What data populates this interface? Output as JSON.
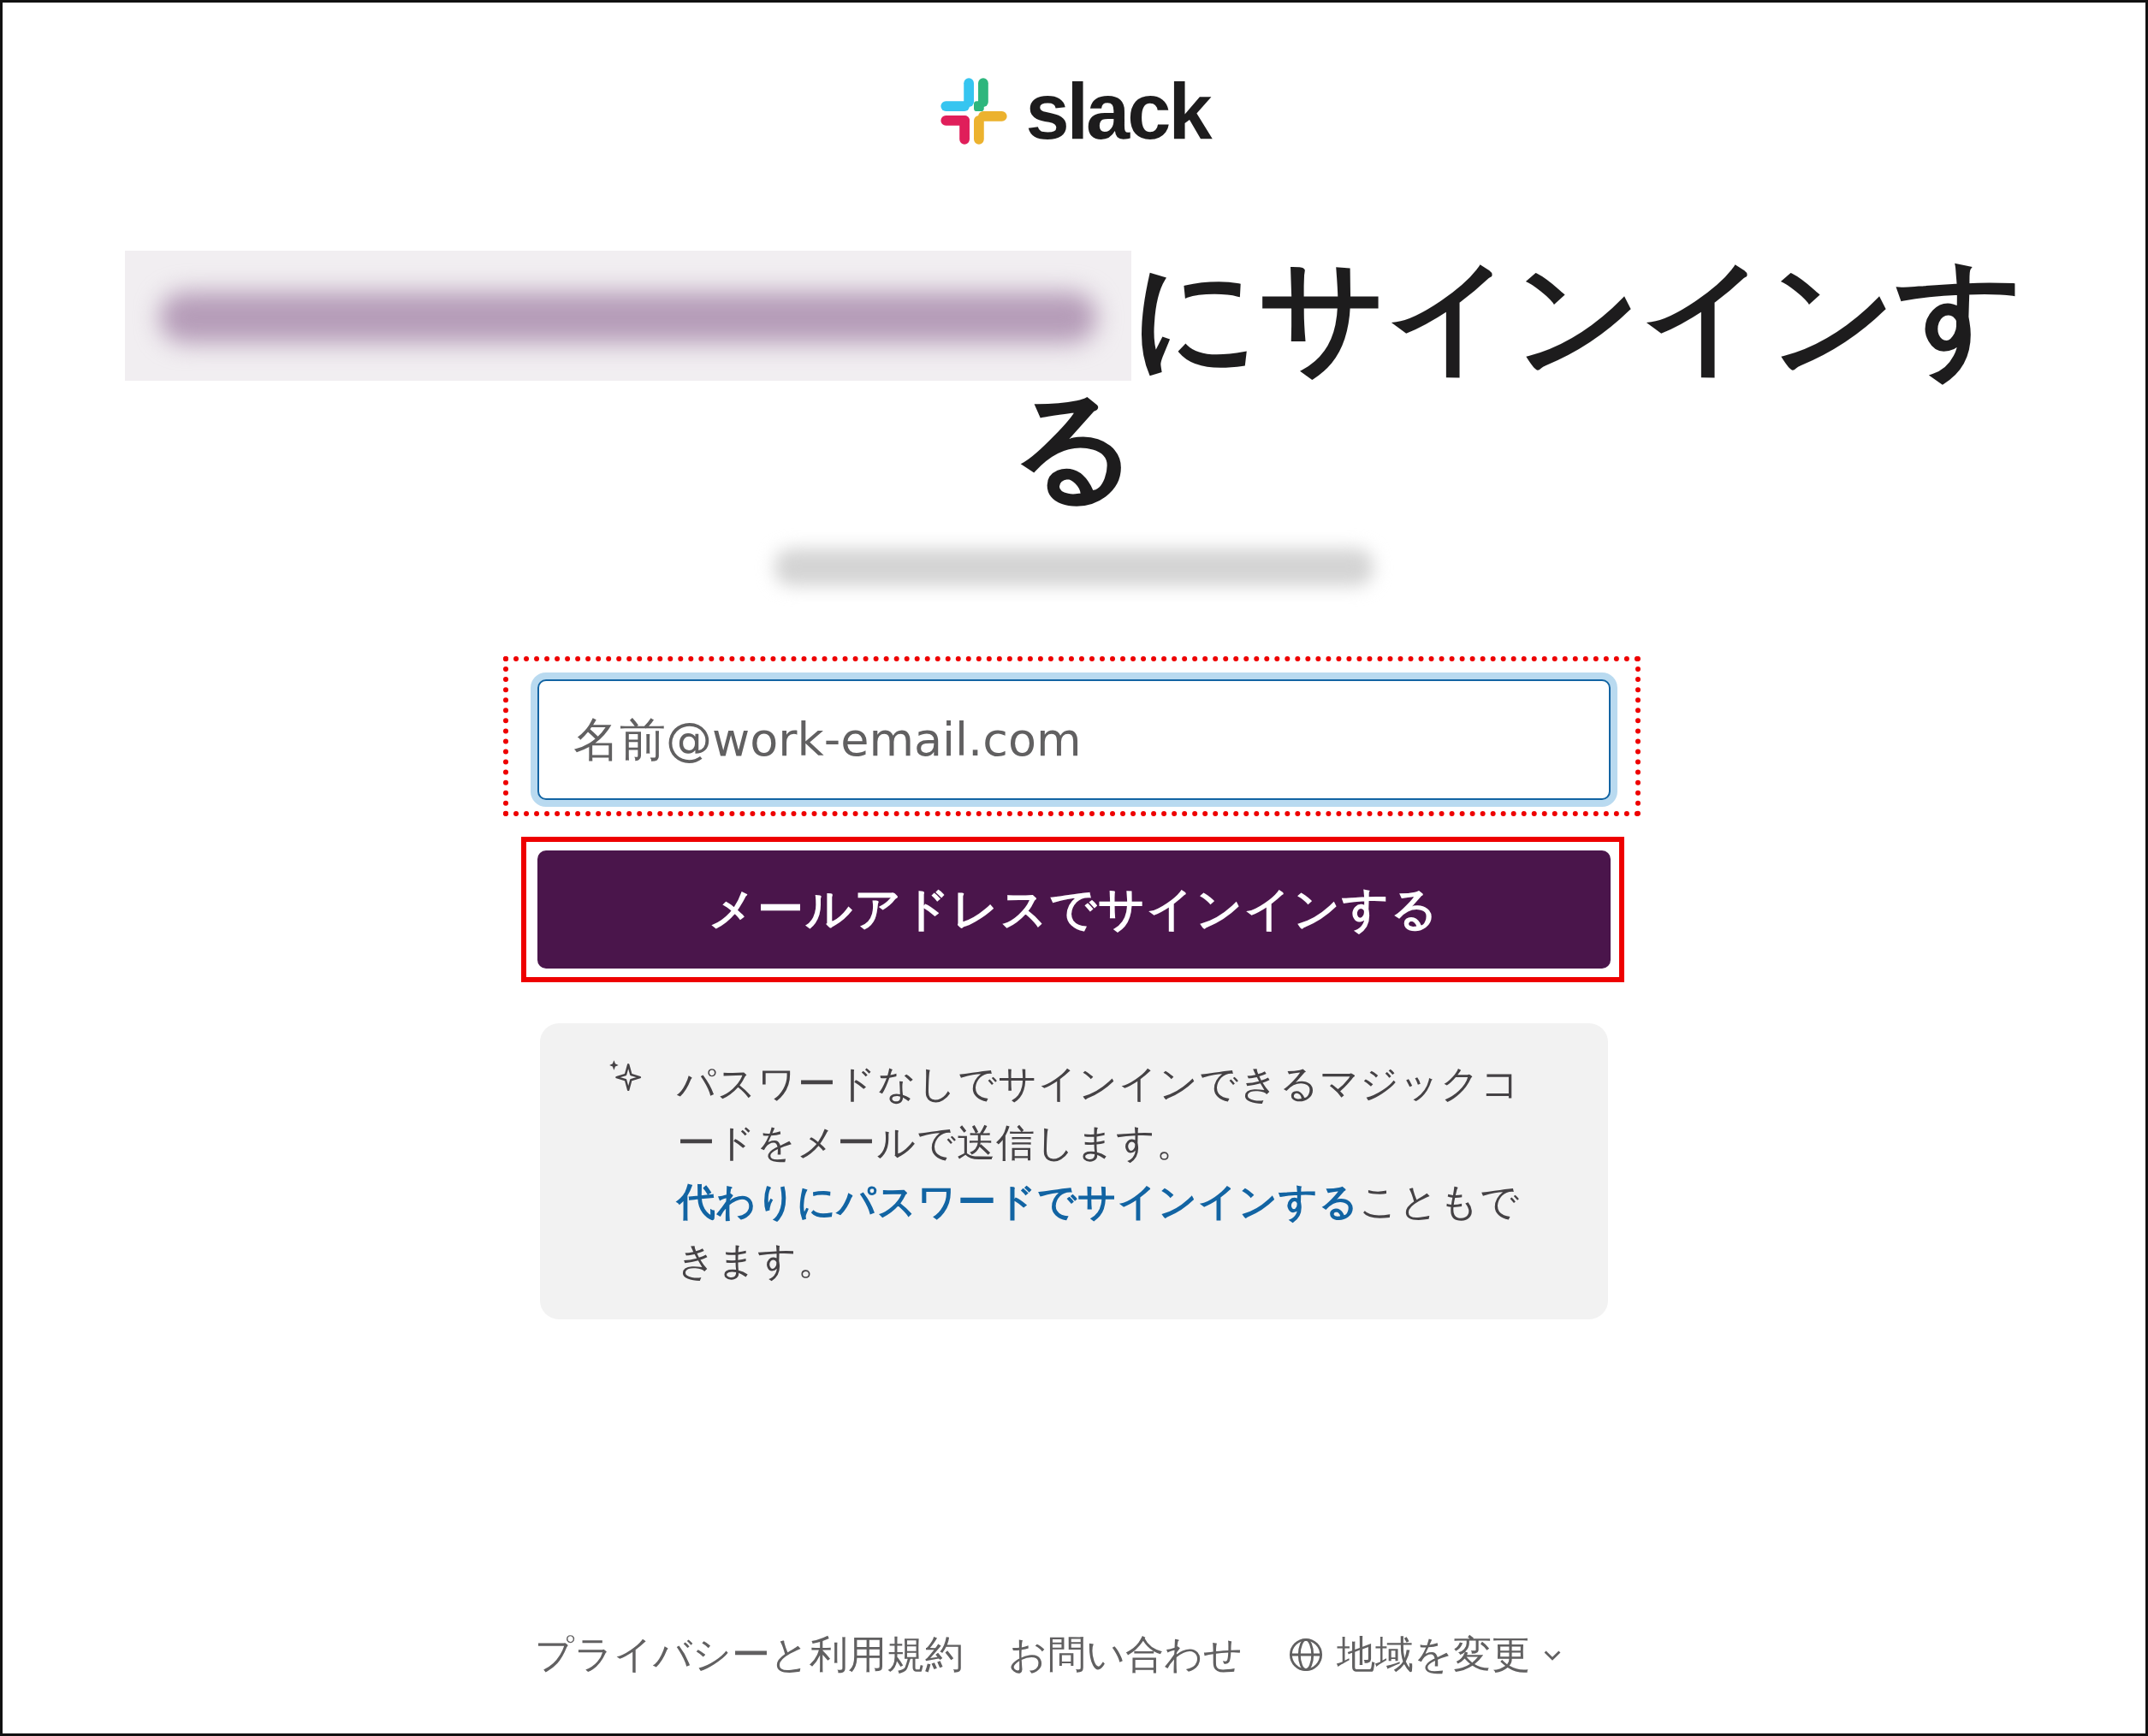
{
  "logo": {
    "wordmark": "slack"
  },
  "heading": {
    "workspace_name_redacted": true,
    "text": "にサインインする"
  },
  "workspace_url": {
    "redacted": true
  },
  "email_field": {
    "placeholder": "名前@work-email.com",
    "focused": true,
    "annotation_outline": true
  },
  "sign_in_button": {
    "label": "メールアドレスでサインインする",
    "annotation_outline": true
  },
  "magic_code_note": {
    "text": "パスワードなしでサインインできるマジックコードをメールで送信します。",
    "link": "代わりにパスワードでサインインする",
    "text_after": "こともできます。"
  },
  "footer": {
    "links": [
      "プライバシーと利用規約",
      "お問い合わせ"
    ],
    "region": "地域を変更"
  }
}
